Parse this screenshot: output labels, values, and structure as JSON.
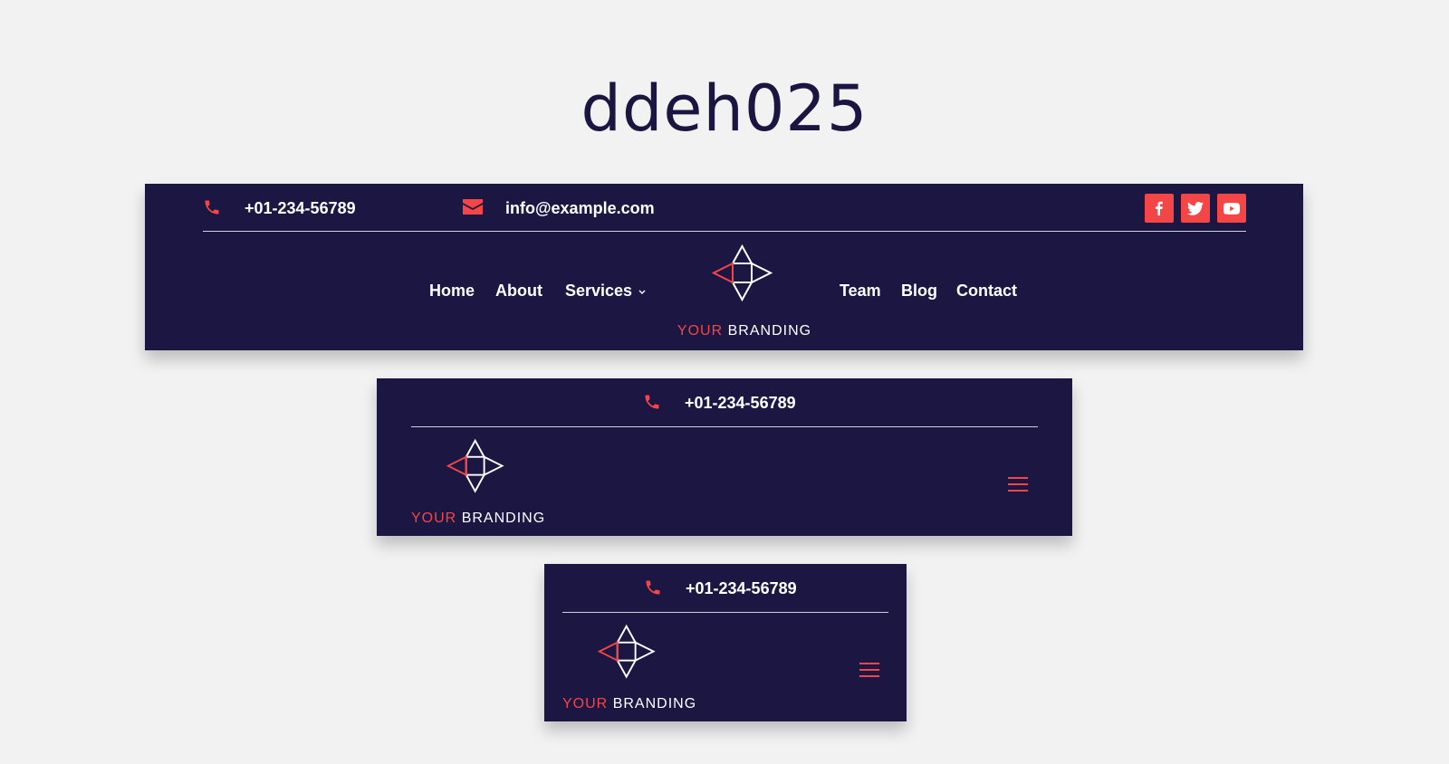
{
  "page": {
    "title": "ddeh025"
  },
  "colors": {
    "background": "#f2f2f2",
    "header_bg": "#1b1642",
    "accent": "#f44646",
    "text": "#ffffff"
  },
  "contact": {
    "phone": "+01-234-56789",
    "email": "info@example.com"
  },
  "social": [
    {
      "name": "facebook",
      "icon": "facebook-icon"
    },
    {
      "name": "twitter",
      "icon": "twitter-icon"
    },
    {
      "name": "youtube",
      "icon": "youtube-icon"
    }
  ],
  "nav": {
    "items": [
      "Home",
      "About",
      "Services",
      "Team",
      "Blog",
      "Contact"
    ]
  },
  "brand": {
    "accent_word": "YOUR",
    "main_word": "BRANDING"
  },
  "icons": {
    "phone": "phone-icon",
    "email": "envelope-icon",
    "logo": "diamond-arrows-logo-icon",
    "menu": "hamburger-menu-icon",
    "dropdown": "chevron-down-icon"
  }
}
